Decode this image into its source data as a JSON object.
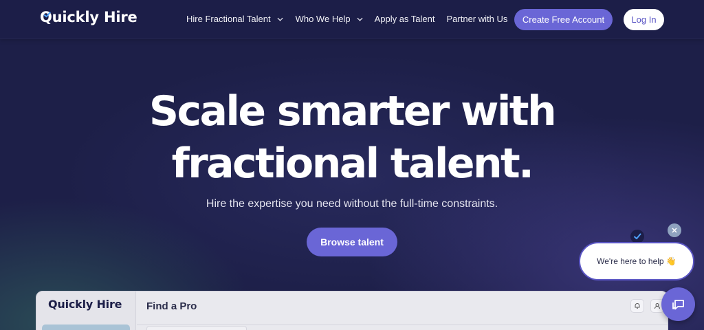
{
  "brand": {
    "name_q": "Q",
    "name_rest": "uickly Hire"
  },
  "nav": {
    "items": [
      {
        "label": "Hire Fractional Talent",
        "has_dropdown": true
      },
      {
        "label": "Who We Help",
        "has_dropdown": true
      },
      {
        "label": "Apply as Talent",
        "has_dropdown": false
      },
      {
        "label": "Partner with Us",
        "has_dropdown": false
      }
    ],
    "create_account_label": "Create Free Account",
    "login_label": "Log In"
  },
  "hero": {
    "title_line1": "Scale smarter with",
    "title_line2": "fractional talent.",
    "subtitle": "Hire the expertise you need without the full-time constraints.",
    "cta_label": "Browse talent"
  },
  "preview": {
    "logo": "Quickly Hire",
    "page_title": "Find a Pro",
    "icons": [
      "bell-icon",
      "user-icon"
    ]
  },
  "chat": {
    "message": "We're here to help 👋",
    "icons": [
      "close-icon",
      "check-avatar-icon",
      "chat-icon"
    ]
  },
  "colors": {
    "background": "#1d1f48",
    "accent": "#6a66d6",
    "white": "#ffffff"
  }
}
